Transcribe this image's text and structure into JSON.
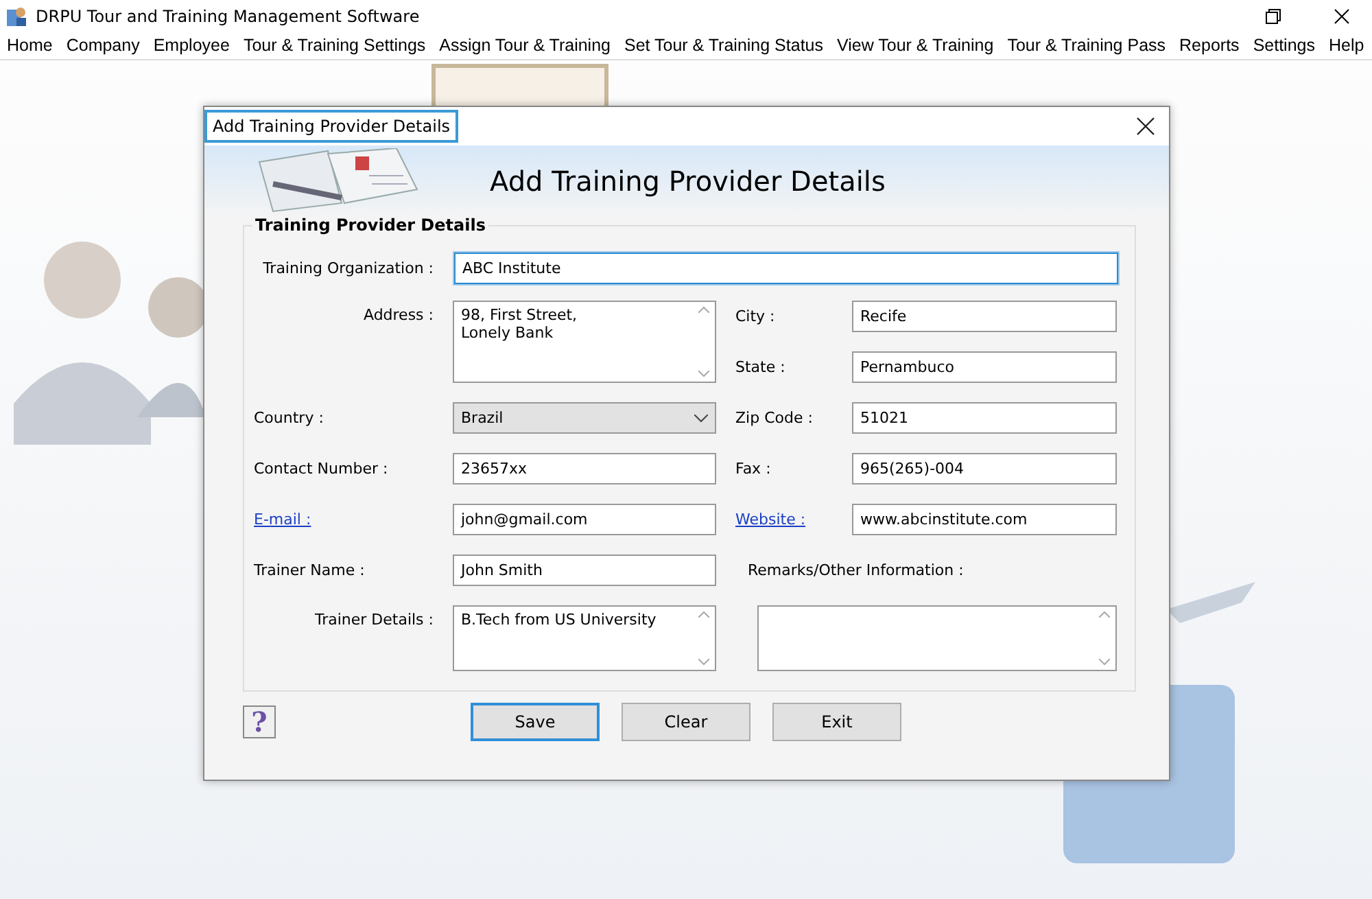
{
  "window": {
    "title": "DRPU Tour and Training Management Software"
  },
  "menu": [
    "Home",
    "Company",
    "Employee",
    "Tour & Training Settings",
    "Assign Tour & Training",
    "Set Tour & Training Status",
    "View Tour & Training",
    "Tour & Training Pass",
    "Reports",
    "Settings",
    "Help"
  ],
  "dialog": {
    "title": "Add Training Provider Details",
    "heading": "Add Training Provider Details",
    "group_title": "Training Provider Details",
    "organization": {
      "label": "Training Organization :",
      "value": "ABC Institute",
      "focused": true
    },
    "left_fields": [
      {
        "kind": "multiline",
        "label": "Address :",
        "link": false,
        "value": "98, First Street,\nLonely Bank"
      },
      {
        "kind": "select",
        "label": "Country :",
        "link": false,
        "value": "Brazil"
      },
      {
        "kind": "text",
        "label": "Contact Number :",
        "link": false,
        "value": "23657xx"
      },
      {
        "kind": "text",
        "label": "E-mail :",
        "link": true,
        "value": "john@gmail.com"
      },
      {
        "kind": "text",
        "label": "Trainer Name :",
        "link": false,
        "value": "John Smith"
      },
      {
        "kind": "multiline",
        "label": "Trainer Details :",
        "link": false,
        "value": "B.Tech from US University"
      }
    ],
    "right_fields": [
      {
        "kind": "text",
        "label": "City :",
        "link": false,
        "value": "Recife"
      },
      {
        "kind": "text",
        "label": "State :",
        "link": false,
        "value": "Pernambuco"
      },
      {
        "kind": "text",
        "label": "Zip Code :",
        "link": false,
        "value": "51021"
      },
      {
        "kind": "text",
        "label": "Fax :",
        "link": false,
        "value": "965(265)-004"
      },
      {
        "kind": "text",
        "label": "Website :",
        "link": true,
        "value": "www.abcinstitute.com"
      },
      {
        "kind": "multiline-below",
        "label": "Remarks/Other Information :"
      }
    ],
    "help_button": "?",
    "buttons": [
      {
        "label": "Save",
        "focused": true
      },
      {
        "label": "Clear",
        "focused": false
      },
      {
        "label": "Exit",
        "focused": false
      }
    ]
  }
}
